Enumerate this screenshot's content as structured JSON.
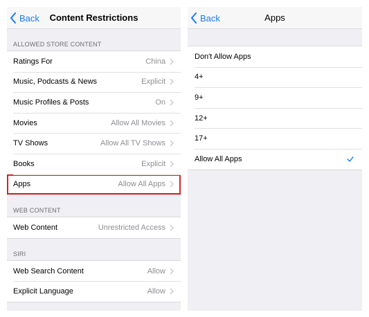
{
  "left": {
    "back_label": "Back",
    "title": "Content Restrictions",
    "sections": [
      {
        "header": "ALLOWED STORE CONTENT",
        "rows": [
          {
            "label": "Ratings For",
            "value": "China"
          },
          {
            "label": "Music, Podcasts & News",
            "value": "Explicit"
          },
          {
            "label": "Music Profiles & Posts",
            "value": "On"
          },
          {
            "label": "Movies",
            "value": "Allow All Movies"
          },
          {
            "label": "TV Shows",
            "value": "Allow All TV Shows"
          },
          {
            "label": "Books",
            "value": "Explicit"
          },
          {
            "label": "Apps",
            "value": "Allow All Apps"
          }
        ]
      },
      {
        "header": "WEB CONTENT",
        "rows": [
          {
            "label": "Web Content",
            "value": "Unrestricted Access"
          }
        ]
      },
      {
        "header": "SIRI",
        "rows": [
          {
            "label": "Web Search Content",
            "value": "Allow"
          },
          {
            "label": "Explicit Language",
            "value": "Allow"
          }
        ]
      }
    ]
  },
  "right": {
    "back_label": "Back",
    "title": "Apps",
    "options": [
      "Don't Allow Apps",
      "4+",
      "9+",
      "12+",
      "17+",
      "Allow All Apps"
    ],
    "selected_index": 5
  },
  "colors": {
    "accent": "#1a7bf6",
    "highlight_border": "#d3222a",
    "background": "#efeff4"
  }
}
